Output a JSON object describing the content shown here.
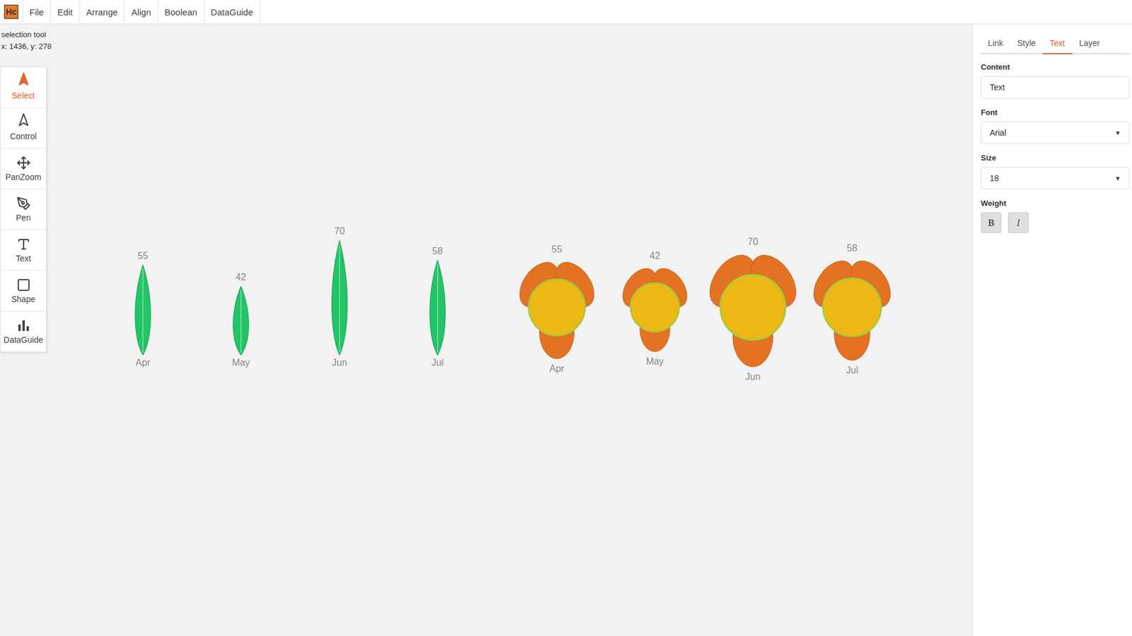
{
  "app": {
    "logo": "Hc"
  },
  "menu": [
    "File",
    "Edit",
    "Arrange",
    "Align",
    "Boolean",
    "DataGuide"
  ],
  "status": {
    "tool": "selection tool",
    "coords": "x: 1436, y: 278"
  },
  "tools": [
    {
      "label": "Select",
      "selected": true
    },
    {
      "label": "Control",
      "selected": false
    },
    {
      "label": "PanZoom",
      "selected": false
    },
    {
      "label": "Pen",
      "selected": false
    },
    {
      "label": "Text",
      "selected": false
    },
    {
      "label": "Shape",
      "selected": false
    },
    {
      "label": "DataGuide",
      "selected": false
    }
  ],
  "panel": {
    "tabs": [
      {
        "label": "Link",
        "selected": false
      },
      {
        "label": "Style",
        "selected": false
      },
      {
        "label": "Text",
        "selected": true
      },
      {
        "label": "Layer",
        "selected": false
      }
    ],
    "content": {
      "label": "Content",
      "value": "Text"
    },
    "font": {
      "label": "Font",
      "value": "Arial"
    },
    "size": {
      "label": "Size",
      "value": "18"
    },
    "weight": {
      "label": "Weight",
      "buttons": [
        {
          "label": "B",
          "selected": false
        },
        {
          "label": "I",
          "selected": false
        }
      ]
    }
  },
  "charts": [
    {
      "kind": "leaf",
      "values": [
        55,
        42,
        70,
        58
      ],
      "value_labels": [
        "55",
        "42",
        "70",
        "58"
      ],
      "categories": [
        "Apr",
        "May",
        "Jun",
        "Jul"
      ]
    },
    {
      "kind": "flower",
      "values": [
        55,
        42,
        70,
        58
      ],
      "value_labels": [
        "55",
        "42",
        "70",
        "58"
      ],
      "categories": [
        "Apr",
        "May",
        "Jun",
        "Jul"
      ]
    }
  ]
}
